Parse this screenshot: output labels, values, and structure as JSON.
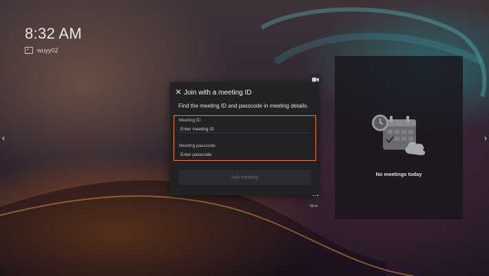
{
  "status": {
    "time": "8:32 AM",
    "device_name": "wuyy02"
  },
  "nav": {
    "left_arrow": "‹",
    "right_arrow": "›"
  },
  "side_actions": {
    "more_label": "More"
  },
  "dialog": {
    "close_glyph": "✕",
    "title": "Join with a meeting ID",
    "description": "Find the meeting ID and passcode in meeting details.",
    "meeting_id": {
      "label": "Meeting ID",
      "placeholder": "Enter meeting ID",
      "value": ""
    },
    "passcode": {
      "label": "Meeting passcode",
      "placeholder": "Enter passcode",
      "value": ""
    },
    "join_button": "Join meeting",
    "highlight_color": "#ee7a22"
  },
  "meetings_panel": {
    "empty_text": "No meetings today"
  }
}
